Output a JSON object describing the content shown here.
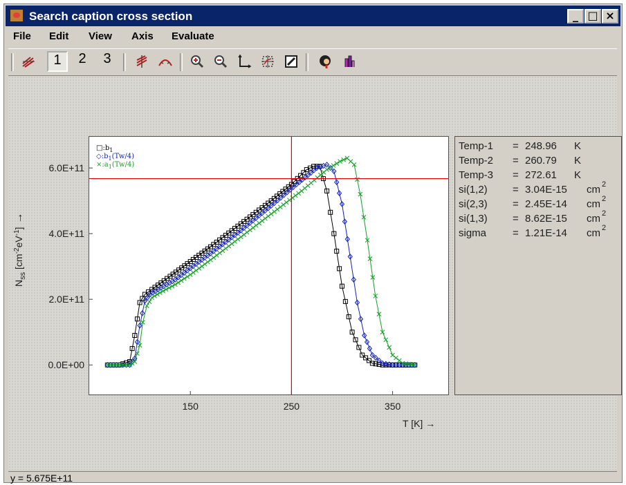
{
  "window": {
    "title": "Search caption cross section",
    "controls": [
      "_",
      "□",
      "×"
    ]
  },
  "menu": [
    "File",
    "Edit",
    "View",
    "Axis",
    "Evaluate"
  ],
  "toolbar": {
    "buttons": [
      "curve-tool-icon",
      "1",
      "2",
      "3",
      "add-marker-icon",
      "peak-icon",
      "zoom-in-icon",
      "zoom-out-icon",
      "axes-icon",
      "fit-icon",
      "edit-icon",
      "portrait-icon",
      "chart-bars-icon"
    ],
    "pressed": "1"
  },
  "readout": [
    {
      "name": "Temp-1",
      "eq": "=",
      "value": "248.96",
      "unit": "K"
    },
    {
      "name": "Temp-2",
      "eq": "=",
      "value": "260.79",
      "unit": "K"
    },
    {
      "name": "Temp-3",
      "eq": "=",
      "value": "272.61",
      "unit": "K"
    },
    {
      "name": "si(1,2)",
      "eq": "=",
      "value": "3.04E-15",
      "unit": "cm",
      "sup": "2"
    },
    {
      "name": "si(2,3)",
      "eq": "=",
      "value": "2.45E-14",
      "unit": "cm",
      "sup": "2"
    },
    {
      "name": "si(1,3)",
      "eq": "=",
      "value": "8.62E-15",
      "unit": "cm",
      "sup": "2"
    },
    {
      "name": "sigma",
      "eq": "=",
      "value": "1.21E-14",
      "unit": "cm",
      "sup": "2"
    }
  ],
  "status": "y = 5.675E+11",
  "chart_data": {
    "type": "line",
    "ylabel": {
      "base": "N",
      "sub": "ss",
      "bracket_open": " [cm",
      "sup1": "-2",
      "mid": "eV",
      "sup2": "-1",
      "bracket_close": "]",
      "arrow": "→"
    },
    "xlabel": "T [K] →",
    "x_ticks": [
      "150",
      "250",
      "350"
    ],
    "y_ticks": [
      "0.0E+00",
      "2.0E+11",
      "4.0E+11",
      "6.0E+11"
    ],
    "xlim": [
      50,
      405
    ],
    "ylim": [
      -90000000000.0,
      695000000000.0
    ],
    "cursor": {
      "x": 250,
      "y": 567500000000.0,
      "color": "#e00000"
    },
    "legend_position": "top-left",
    "series": [
      {
        "name": "b1",
        "legend": {
          "marker": "□",
          "base": ":b",
          "sub": "1",
          "tail": ""
        },
        "marker": "square",
        "color": "#000000",
        "x": [
          68,
          80,
          90,
          95,
          100,
          105,
          112,
          130,
          150,
          170,
          200,
          230,
          250,
          265,
          272,
          278,
          285,
          292,
          300,
          310,
          320,
          330,
          340,
          350,
          360,
          372
        ],
        "y": [
          0,
          0,
          10000000000.0,
          90000000000.0,
          190000000000.0,
          215000000000.0,
          230000000000.0,
          270000000000.0,
          315000000000.0,
          360000000000.0,
          430000000000.0,
          500000000000.0,
          550000000000.0,
          595000000000.0,
          605000000000.0,
          605000000000.0,
          530000000000.0,
          400000000000.0,
          240000000000.0,
          100000000000.0,
          30000000000.0,
          5000000000.0,
          0,
          0,
          0,
          0
        ]
      },
      {
        "name": "b1(Tw/4)",
        "legend": {
          "marker": "◇",
          "base": ":b",
          "sub": "1",
          "tail": "(Tw/4)"
        },
        "marker": "diamond",
        "color": "#1020c0",
        "x": [
          68,
          80,
          90,
          95,
          100,
          105,
          110,
          118,
          135,
          150,
          170,
          200,
          230,
          255,
          275,
          285,
          292,
          300,
          308,
          315,
          322,
          330,
          340,
          350,
          360,
          372
        ],
        "y": [
          0,
          0,
          0,
          20000000000.0,
          120000000000.0,
          195000000000.0,
          215000000000.0,
          230000000000.0,
          260000000000.0,
          295000000000.0,
          340000000000.0,
          410000000000.0,
          485000000000.0,
          550000000000.0,
          600000000000.0,
          610000000000.0,
          590000000000.0,
          490000000000.0,
          330000000000.0,
          190000000000.0,
          90000000000.0,
          30000000000.0,
          5000000000.0,
          0,
          0,
          0
        ]
      },
      {
        "name": "a1(Tw/4)",
        "legend": {
          "marker": "×",
          "base": ":a",
          "sub": "1",
          "tail": "(Tw/4)"
        },
        "marker": "cross",
        "color": "#10a020",
        "x": [
          68,
          80,
          90,
          95,
          100,
          103,
          107,
          112,
          120,
          135,
          150,
          170,
          200,
          230,
          260,
          285,
          298,
          305,
          312,
          318,
          325,
          333,
          340,
          350,
          360,
          372
        ],
        "y": [
          0,
          0,
          0,
          10000000000.0,
          60000000000.0,
          130000000000.0,
          180000000000.0,
          205000000000.0,
          220000000000.0,
          245000000000.0,
          275000000000.0,
          320000000000.0,
          390000000000.0,
          460000000000.0,
          530000000000.0,
          595000000000.0,
          620000000000.0,
          630000000000.0,
          610000000000.0,
          520000000000.0,
          380000000000.0,
          210000000000.0,
          100000000000.0,
          30000000000.0,
          5000000000.0,
          0
        ]
      }
    ]
  }
}
